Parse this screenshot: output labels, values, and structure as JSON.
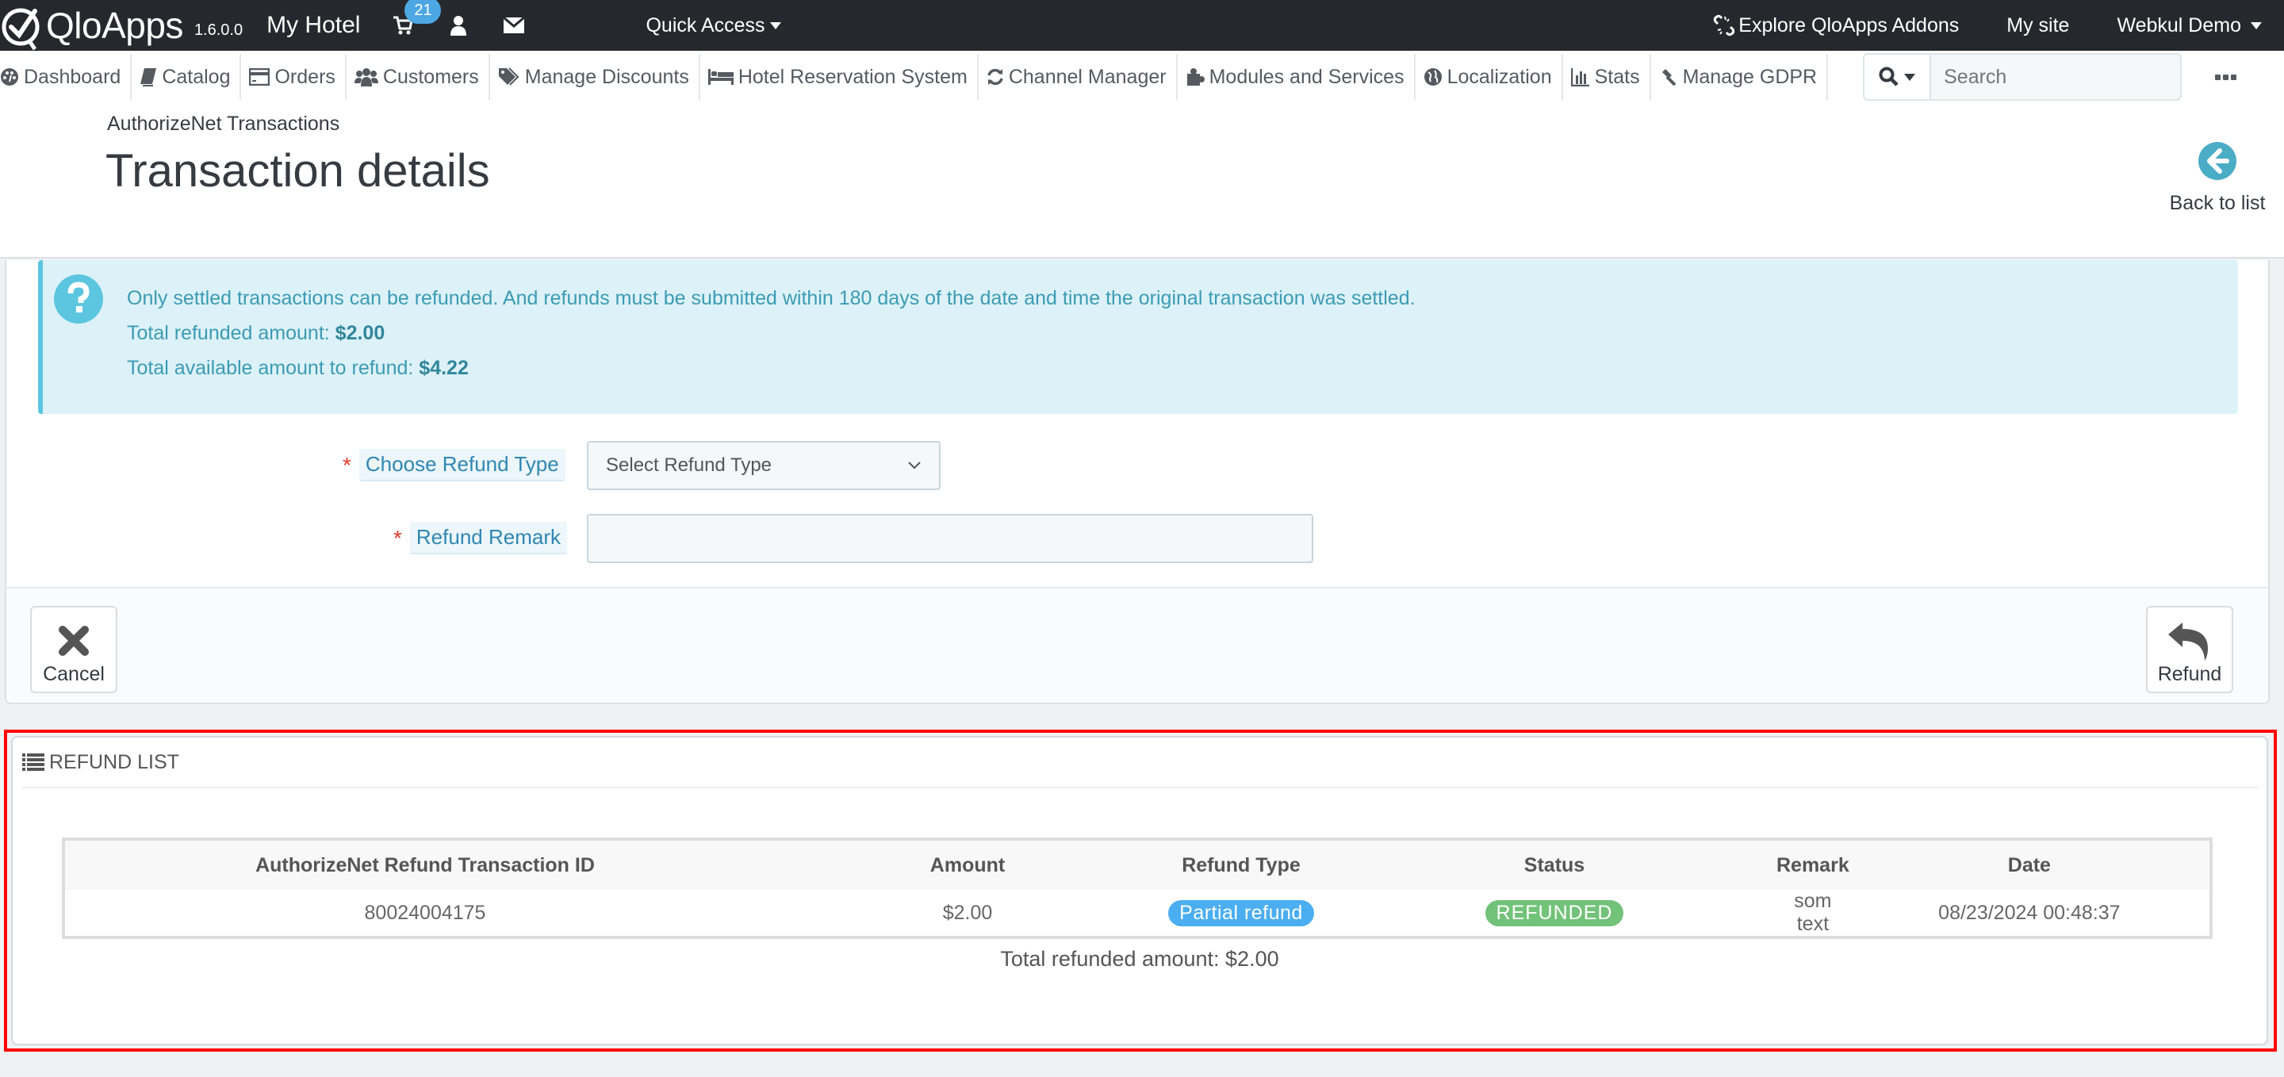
{
  "topbar": {
    "brand": "QloApps",
    "version": "1.6.0.0",
    "shop_name": "My Hotel",
    "cart_badge": "21",
    "quick_access": "Quick Access",
    "addons": "Explore QloApps Addons",
    "my_site": "My site",
    "employee": "Webkul Demo"
  },
  "nav": {
    "items": [
      {
        "label": "Dashboard",
        "icon": "dashboard-icon"
      },
      {
        "label": "Catalog",
        "icon": "book-icon"
      },
      {
        "label": "Orders",
        "icon": "credit-card-icon"
      },
      {
        "label": "Customers",
        "icon": "users-icon"
      },
      {
        "label": "Manage Discounts",
        "icon": "tags-icon"
      },
      {
        "label": "Hotel Reservation System",
        "icon": "bed-icon"
      },
      {
        "label": "Channel Manager",
        "icon": "refresh-icon"
      },
      {
        "label": "Modules and Services",
        "icon": "puzzle-icon"
      },
      {
        "label": "Localization",
        "icon": "globe-icon"
      },
      {
        "label": "Stats",
        "icon": "bar-chart-icon"
      },
      {
        "label": "Manage GDPR",
        "icon": "gavel-icon"
      }
    ],
    "search_placeholder": "Search"
  },
  "page": {
    "breadcrumb": "AuthorizeNet Transactions",
    "title": "Transaction details",
    "back_label": "Back to list"
  },
  "alert": {
    "line1": "Only settled transactions can be refunded. And refunds must be submitted within 180 days of the date and time the original transaction was settled.",
    "refunded_label": "Total refunded amount: ",
    "refunded_value": "$2.00",
    "available_label": "Total available amount to refund: ",
    "available_value": "$4.22"
  },
  "form": {
    "refund_type_label": "Choose Refund Type",
    "refund_type_value": "Select Refund Type",
    "refund_remark_label": "Refund Remark",
    "refund_remark_value": "",
    "required_mark": "*",
    "cancel_label": "Cancel",
    "refund_label": "Refund"
  },
  "refund_list": {
    "heading": "Refund List",
    "columns": [
      "AuthorizeNet Refund Transaction ID",
      "Amount",
      "Refund Type",
      "Status",
      "Remark",
      "Date"
    ],
    "rows": [
      {
        "transaction_id": "80024004175",
        "amount": "$2.00",
        "refund_type": "Partial refund",
        "status": "REFUNDED",
        "remark": "som text",
        "date": "08/23/2024 00:48:37"
      }
    ],
    "total": "Total refunded amount: $2.00"
  },
  "colors": {
    "topbar_bg": "#25282d",
    "badge_blue": "#4ca7e3",
    "info_blue": "#5cc6e0",
    "type_pill": "#4aaef0",
    "status_pill": "#72c279",
    "highlight_frame": "#ff0000"
  }
}
